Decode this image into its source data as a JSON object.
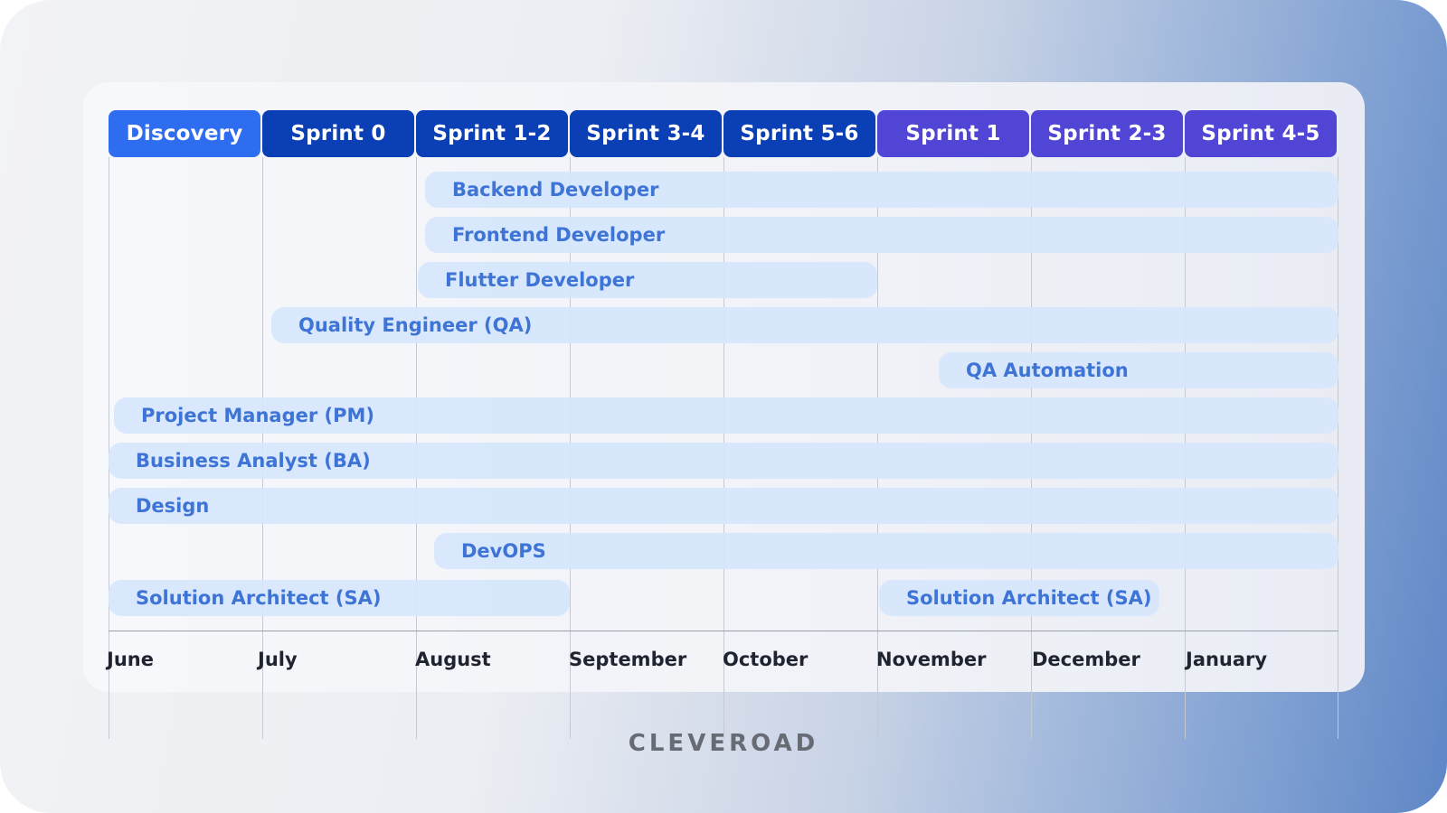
{
  "phases": [
    {
      "label": "Discovery",
      "color": "#2f6df0"
    },
    {
      "label": "Sprint 0",
      "color": "#0b3fb5"
    },
    {
      "label": "Sprint 1-2",
      "color": "#0b3fb5"
    },
    {
      "label": "Sprint 3-4",
      "color": "#0b3fb5"
    },
    {
      "label": "Sprint 5-6",
      "color": "#0b3fb5"
    },
    {
      "label": "Sprint 1",
      "color": "#5145d6"
    },
    {
      "label": "Sprint 2-3",
      "color": "#5145d6"
    },
    {
      "label": "Sprint 4-5",
      "color": "#5145d6"
    }
  ],
  "roles": [
    {
      "label": "Backend Developer",
      "start_month": "August",
      "end_month": "January"
    },
    {
      "label": "Frontend Developer",
      "start_month": "August",
      "end_month": "January"
    },
    {
      "label": "Flutter Developer",
      "start_month": "August",
      "end_month": "October"
    },
    {
      "label": "Quality Engineer (QA)",
      "start_month": "July",
      "end_month": "January"
    },
    {
      "label": "QA Automation",
      "start_month": "November",
      "end_month": "January"
    },
    {
      "label": "Project Manager (PM)",
      "start_month": "June",
      "end_month": "January"
    },
    {
      "label": "Business Analyst (BA)",
      "start_month": "June",
      "end_month": "January"
    },
    {
      "label": "Design",
      "start_month": "June",
      "end_month": "January"
    },
    {
      "label": "DevOPS",
      "start_month": "August",
      "end_month": "January"
    },
    {
      "label": "Solution Architect (SA)",
      "start_month": "June",
      "end_month": "August"
    },
    {
      "label": "Solution Architect (SA)",
      "start_month": "November",
      "end_month": "December"
    }
  ],
  "months": [
    "June",
    "July",
    "August",
    "September",
    "October",
    "November",
    "December",
    "January"
  ],
  "brand": "CLEVEROAD"
}
